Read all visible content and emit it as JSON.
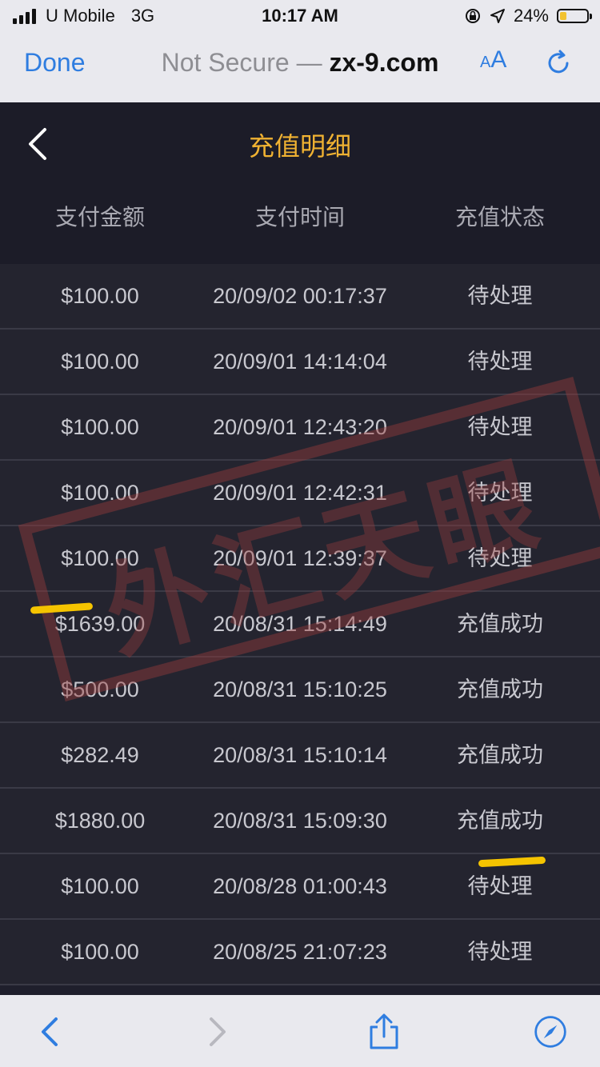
{
  "status_bar": {
    "carrier": "U Mobile",
    "network": "3G",
    "time": "10:17 AM",
    "battery_text": "24%",
    "battery_level": 0.24
  },
  "browser": {
    "done_label": "Done",
    "url_prefix": "Not Secure —",
    "url_domain": "zx-9.com",
    "reader_label_small": "A",
    "reader_label_large": "A"
  },
  "page": {
    "title": "充值明细",
    "columns": [
      "支付金额",
      "支付时间",
      "充值状态"
    ]
  },
  "rows": [
    {
      "amount": "$100.00",
      "time": "20/09/02 00:17:37",
      "status": "待处理"
    },
    {
      "amount": "$100.00",
      "time": "20/09/01 14:14:04",
      "status": "待处理"
    },
    {
      "amount": "$100.00",
      "time": "20/09/01 12:43:20",
      "status": "待处理"
    },
    {
      "amount": "$100.00",
      "time": "20/09/01 12:42:31",
      "status": "待处理"
    },
    {
      "amount": "$100.00",
      "time": "20/09/01 12:39:37",
      "status": "待处理"
    },
    {
      "amount": "$1639.00",
      "time": "20/08/31 15:14:49",
      "status": "充值成功"
    },
    {
      "amount": "$500.00",
      "time": "20/08/31 15:10:25",
      "status": "充值成功"
    },
    {
      "amount": "$282.49",
      "time": "20/08/31 15:10:14",
      "status": "充值成功"
    },
    {
      "amount": "$1880.00",
      "time": "20/08/31 15:09:30",
      "status": "充值成功"
    },
    {
      "amount": "$100.00",
      "time": "20/08/28 01:00:43",
      "status": "待处理"
    },
    {
      "amount": "$100.00",
      "time": "20/08/25 21:07:23",
      "status": "待处理"
    }
  ],
  "watermark": {
    "text": "外汇天眼"
  },
  "colors": {
    "accent_title": "#f0b232",
    "link_blue": "#2f7de0",
    "highlight": "#f5c400"
  },
  "icons": {
    "back": "chevron-left-icon",
    "reload": "reload-icon",
    "nav_back": "arrow-left-icon",
    "nav_forward": "arrow-right-icon",
    "share": "share-icon",
    "compass": "compass-icon"
  }
}
